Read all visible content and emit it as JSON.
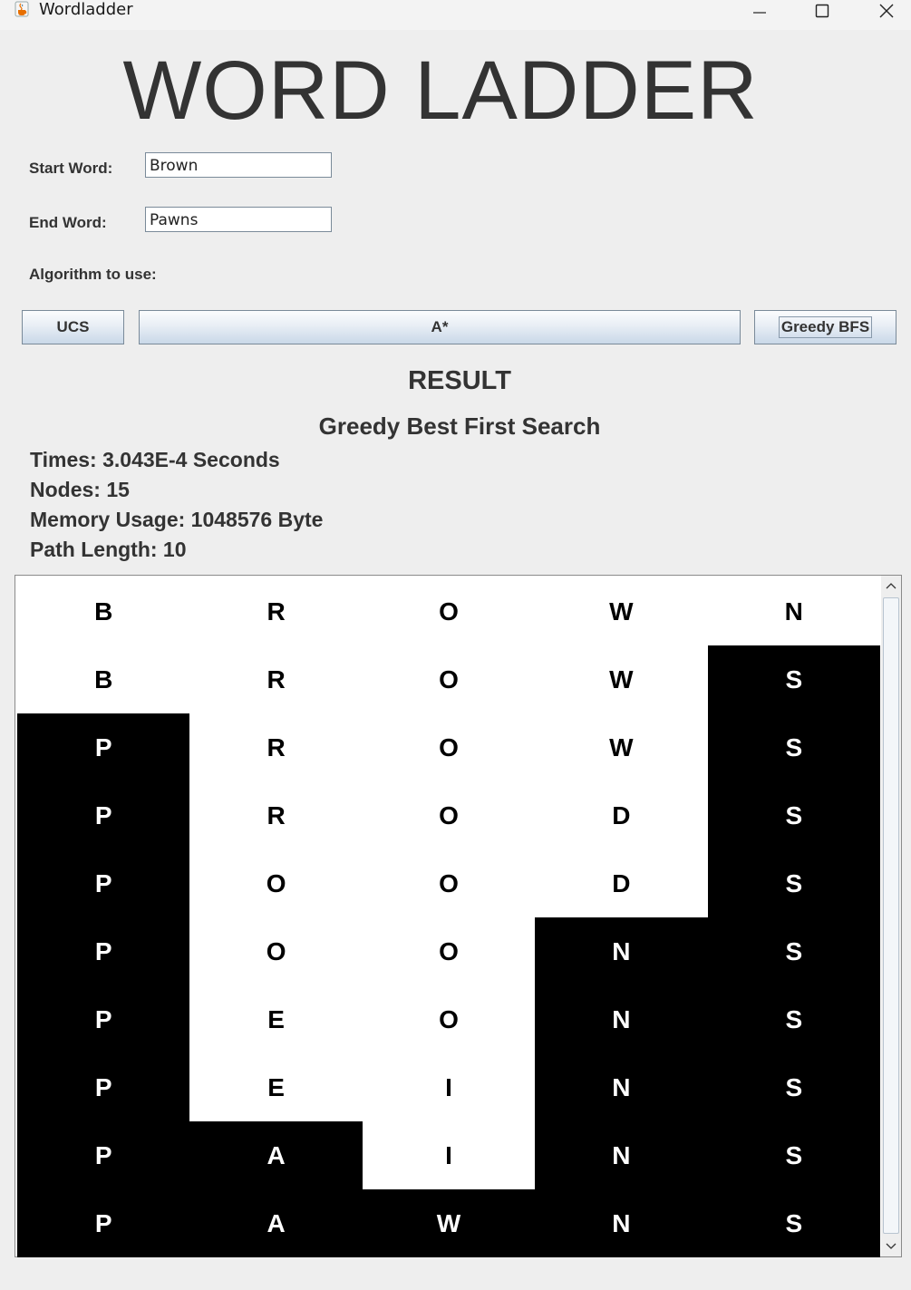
{
  "window": {
    "title": "Wordladder",
    "app_icon": "java-cup-icon",
    "controls": [
      "minimize-icon",
      "maximize-icon",
      "close-icon"
    ]
  },
  "header": {
    "title": "WORD LADDER"
  },
  "form": {
    "start_label": "Start Word:",
    "start_value": "Brown",
    "end_label": "End Word:",
    "end_value": "Pawns",
    "algorithm_label": "Algorithm to use:"
  },
  "buttons": {
    "ucs": "UCS",
    "astar": "A*",
    "greedy": "Greedy BFS"
  },
  "result": {
    "heading": "RESULT",
    "algorithm": "Greedy Best First Search",
    "time": "Times: 3.043E-4 Seconds",
    "nodes": "Nodes: 15",
    "memory": "Memory Usage: 1048576 Byte",
    "path_length": "Path Length: 10"
  },
  "ladder": {
    "rows": [
      "BROWN",
      "BROWS",
      "PROWS",
      "PRODS",
      "POODS",
      "POONS",
      "PEONS",
      "PEINS",
      "PAINS",
      "PAWNS"
    ],
    "highlight_colors": {
      "changed": "#000000",
      "unchanged": "#ffffff"
    }
  },
  "colors": {
    "background": "#eeeeee",
    "text": "#333333",
    "button_gradient_bottom": "#c9d8e8"
  }
}
